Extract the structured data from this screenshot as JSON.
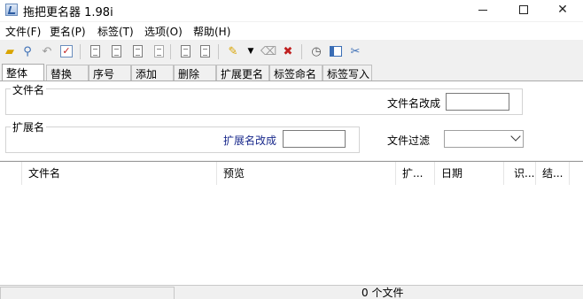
{
  "window": {
    "title": "拖把更名器 1.98i",
    "minimize_icon": "minimize-icon",
    "maximize_icon": "maximize-icon",
    "close_icon": "close-icon"
  },
  "menu": [
    "文件(F)",
    "更名(P)",
    "标签(T)",
    "选项(O)",
    "帮助(H)"
  ],
  "toolbar": {
    "icons": [
      "open-folder-icon",
      "search-icon",
      "undo-icon",
      "checkmark-icon",
      "rename-file-icon",
      "rename-file-icon",
      "rename-file-icon",
      "rename-file-gray-icon",
      "document-icon",
      "document-icon",
      "folder-open-icon",
      "dropdown-arrow-icon",
      "clear-name-icon",
      "delete-name-icon",
      "clock-icon",
      "preview-window-icon",
      "settings-tools-icon"
    ]
  },
  "tabs": [
    "整体",
    "替换",
    "序号",
    "添加",
    "删除",
    "扩展更名",
    "标签命名",
    "标签写入"
  ],
  "filename_group": {
    "legend": "文件名",
    "rename_label": "文件名改成",
    "rename_value": ""
  },
  "extension_group": {
    "legend": "扩展名",
    "rename_label": "扩展名改成",
    "rename_value": ""
  },
  "filter": {
    "label": "文件过滤",
    "value": ""
  },
  "columns": [
    "文件名",
    "预览",
    "扩...",
    "日期",
    "识...",
    "结..."
  ],
  "status": {
    "count_text": "0 个文件"
  }
}
